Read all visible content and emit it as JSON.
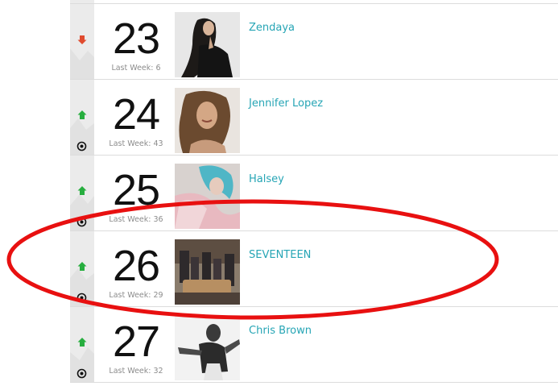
{
  "colors": {
    "accent": "#26a5b5",
    "up": "#27ae3f",
    "down": "#e04b2f",
    "annotation": "#e81010"
  },
  "rows": [
    {
      "rank": "23",
      "last_week": "Last Week: 6",
      "artist": "Zendaya",
      "trend": "down",
      "icon": "arrow-down-icon"
    },
    {
      "rank": "24",
      "last_week": "Last Week: 43",
      "artist": "Jennifer Lopez",
      "trend": "up",
      "icon": "arrow-up-icon"
    },
    {
      "rank": "25",
      "last_week": "Last Week: 36",
      "artist": "Halsey",
      "trend": "up",
      "icon": "arrow-up-icon"
    },
    {
      "rank": "26",
      "last_week": "Last Week: 29",
      "artist": "SEVENTEEN",
      "trend": "up",
      "icon": "arrow-up-icon"
    },
    {
      "rank": "27",
      "last_week": "Last Week: 32",
      "artist": "Chris Brown",
      "trend": "up",
      "icon": "arrow-up-icon"
    }
  ]
}
